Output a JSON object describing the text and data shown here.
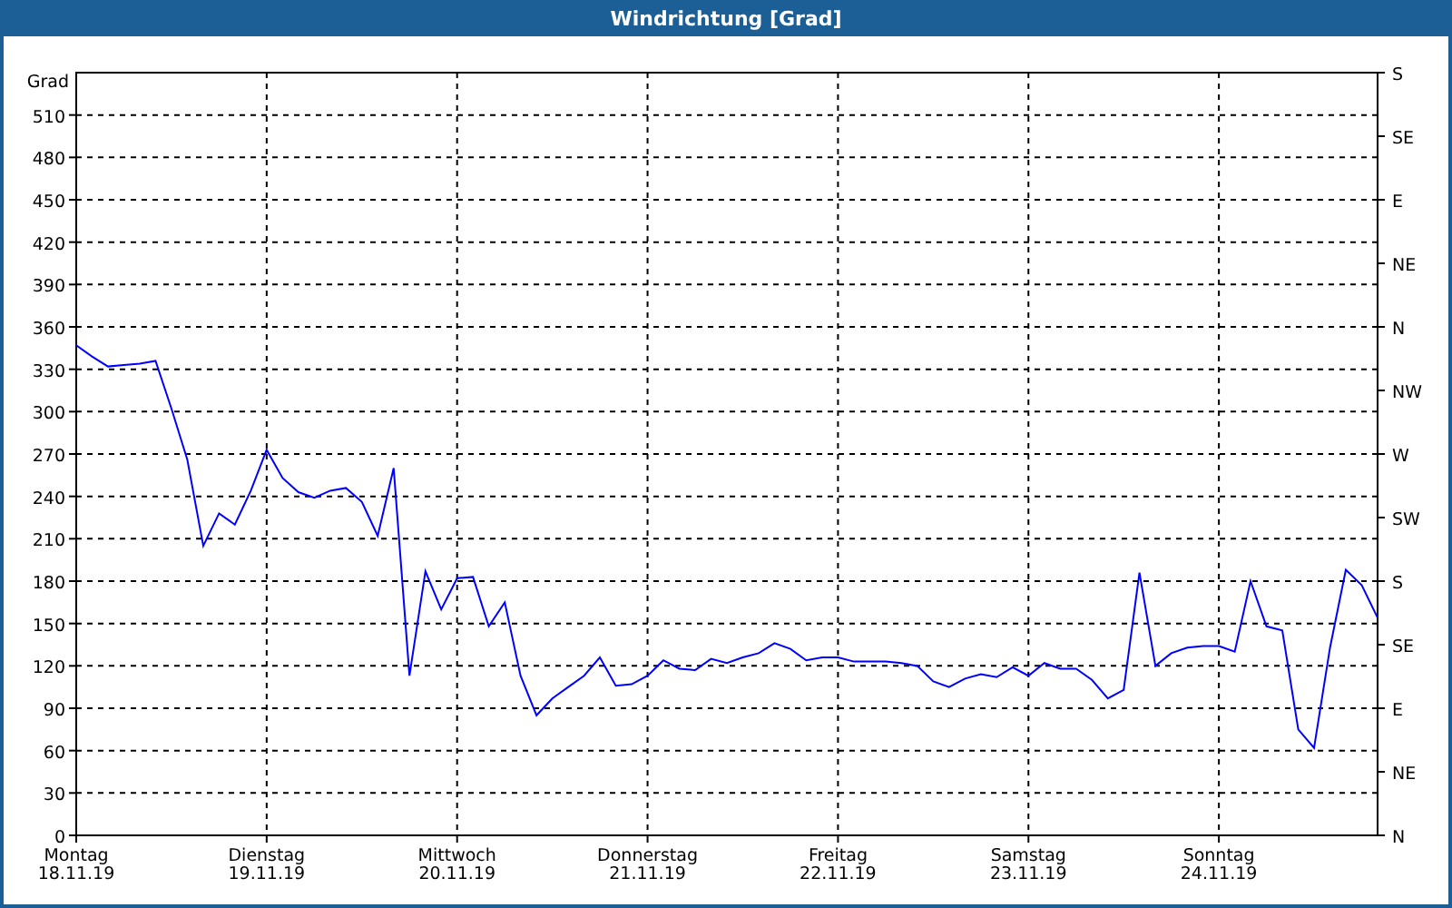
{
  "window": {
    "title": "Windrichtung [Grad]"
  },
  "chart": {
    "right_axis_labels": [
      "S",
      "SE",
      "E",
      "NE",
      "N",
      "NW",
      "W",
      "SW",
      "S",
      "SE",
      "E",
      "NE",
      "N"
    ],
    "dates": [
      "18.11.19",
      "19.11.19",
      "20.11.19",
      "21.11.19",
      "22.11.19",
      "23.11.19",
      "24.11.19"
    ],
    "chart_data": {
      "type": "line",
      "grid": true,
      "ylabel": "Grad",
      "ylim": [
        0,
        540
      ],
      "yticks": [
        0,
        30,
        60,
        90,
        120,
        150,
        180,
        210,
        240,
        270,
        300,
        330,
        360,
        390,
        420,
        450,
        480,
        510
      ],
      "categories": [
        "Montag",
        null,
        null,
        null,
        null,
        null,
        null,
        null,
        null,
        null,
        null,
        null,
        "Dienstag",
        null,
        null,
        null,
        null,
        null,
        null,
        null,
        null,
        null,
        null,
        null,
        "Mittwoch",
        null,
        null,
        null,
        null,
        null,
        null,
        null,
        null,
        null,
        null,
        null,
        "Donnerstag",
        null,
        null,
        null,
        null,
        null,
        null,
        null,
        null,
        null,
        null,
        null,
        "Freitag",
        null,
        null,
        null,
        null,
        null,
        null,
        null,
        null,
        null,
        null,
        null,
        "Samstag",
        null,
        null,
        null,
        null,
        null,
        null,
        null,
        null,
        null,
        null,
        null,
        "Sonntag",
        null,
        null,
        null,
        null,
        null,
        null,
        null,
        null,
        null,
        null
      ],
      "series": [
        {
          "color": "#0000ff",
          "values": [
            347,
            339,
            332,
            333,
            334,
            336,
            302,
            266,
            205,
            228,
            220,
            244,
            273,
            253,
            243,
            239,
            244,
            246,
            236,
            212,
            260,
            113,
            187,
            160,
            182,
            183,
            148,
            165,
            113,
            85,
            97,
            105,
            113,
            126,
            106,
            107,
            113,
            124,
            118,
            117,
            125,
            122,
            126,
            129,
            136,
            132,
            124,
            126,
            126,
            123,
            123,
            123,
            122,
            120,
            109,
            105,
            111,
            114,
            112,
            119,
            113,
            122,
            118,
            118,
            110,
            97,
            103,
            186,
            120,
            129,
            133,
            134,
            134,
            130,
            180,
            148,
            145,
            75,
            62,
            133,
            188,
            177,
            154
          ]
        }
      ]
    }
  }
}
